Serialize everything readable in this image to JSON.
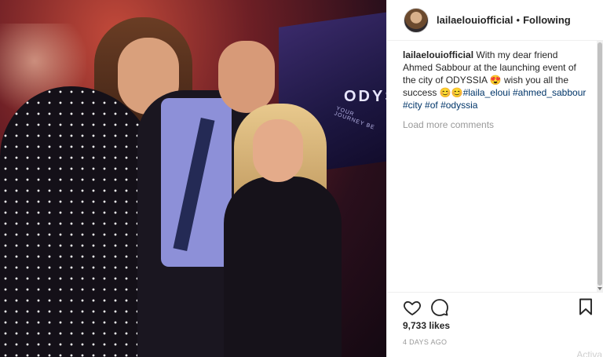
{
  "post": {
    "photo_overlay_text": "ODYS",
    "photo_overlay_sub": "YOUR JOURNEY BE",
    "header": {
      "username": "lailaelouiofficial",
      "separator": "•",
      "follow_status": "Following"
    },
    "caption": {
      "username": "lailaelouiofficial",
      "text": "With my dear friend Ahmed Sabbour at the launching event of the city of ODYSSIA 😍 wish you all the success 😊😊",
      "hashtags": [
        "#laila_eloui",
        "#ahmed_sabbour",
        "#city",
        "#of",
        "#odyssia"
      ]
    },
    "load_more_label": "Load more comments",
    "likes": "9,733 likes",
    "timestamp": "4 DAYS AGO",
    "watermark": "Activa"
  },
  "icons": {
    "like": "heart-outline-icon",
    "comment": "speech-bubble-icon",
    "save": "bookmark-outline-icon"
  },
  "colors": {
    "hashtag": "#003569",
    "muted": "#999999",
    "text": "#262626"
  }
}
